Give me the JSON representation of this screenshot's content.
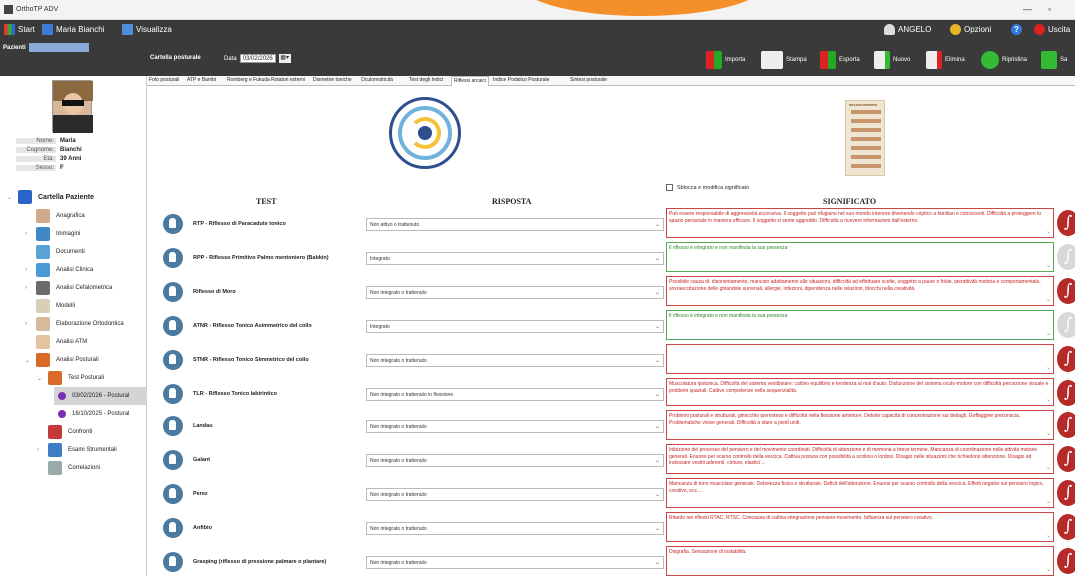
{
  "window": {
    "title": "OrthoTP ADV",
    "minimize": "—",
    "maximize": "▫"
  },
  "topbar": {
    "start": "Start",
    "user": "Maria Bianchi",
    "visualizza": "Visualizza",
    "account": "ANGELO",
    "options": "Opzioni",
    "help": "?",
    "exit": "Uscita"
  },
  "toolbar": {
    "pazienti": "Pazienti",
    "cartella": "Cartella posturale",
    "data_label": "Data",
    "data_value": "03/02/2026",
    "importa": "Importa",
    "stampa": "Stampa",
    "esporta": "Esporta",
    "nuovo": "Nuovo",
    "elimina": "Elimina",
    "ripristina": "Ripristina",
    "salva": "Sa"
  },
  "patient": {
    "nome_label": "Nome:",
    "nome": "Maria",
    "cognome_label": "Cognome:",
    "cognome": "Bianchi",
    "eta_label": "Età:",
    "eta": "39 Anni",
    "sesso_label": "Sesso:",
    "sesso": "F"
  },
  "tree": [
    {
      "label": "Cartella Paziente",
      "bold": true
    },
    {
      "label": "Anagrafica"
    },
    {
      "label": "Immagini"
    },
    {
      "label": "Documenti"
    },
    {
      "label": "Analisi Clinica"
    },
    {
      "label": "Analisi Cefalometrica"
    },
    {
      "label": "Modelli"
    },
    {
      "label": "Elaborazione Ortodontica"
    },
    {
      "label": "Analisi ATM"
    },
    {
      "label": "Analisi Posturali"
    },
    {
      "label": "Test Posturali"
    },
    {
      "label": "03/02/2026 - Postural"
    },
    {
      "label": "16/10/2025 - Postural"
    },
    {
      "label": "Confronti"
    },
    {
      "label": "Esami Strumentali"
    },
    {
      "label": "Correlazioni"
    }
  ],
  "tabs": [
    "Foto posturali",
    "ATP e Bambi",
    "Romberg e Fukuda",
    "Rotatori esterni",
    "Dismetrie toniche",
    "Oculomotricità",
    "Test degli Indici",
    "Riflessi arcaici",
    "Indice Podalico Posturale",
    "Sintesi posturale"
  ],
  "active_tab": 7,
  "content": {
    "test_header": "TEST",
    "risposta_header": "RISPOSTA",
    "significato_header": "SIGNIFICATO",
    "checkbox_label": "Sblocca e modifica significato",
    "poster_title": "RIFLESSI PRIMITIVI"
  },
  "rows": [
    {
      "label": "RTP - Riflesso di Paracadute tonico",
      "risposta": "Non attivo o trattenuto",
      "significato": "Può essere responsabile di aggressività eccessiva. Il soggetto può rifugiarsi nel suo mondo interiore divenendo criptico a familiari e conoscenti. Difficoltà a proteggere lo spazio personale in maniera efficace. Il soggetto si sente aggredito. Difficoltà a ricevere informazioni dall'esterno.",
      "ok": false
    },
    {
      "label": "RPP - Riflesso Primitivo Palmo mentoniero (Babkin)",
      "risposta": "Integrato",
      "significato": "Il riflesso è integrato e non manifesta la sua presenza",
      "ok": true
    },
    {
      "label": "Riflesso di Moro",
      "risposta": "Non integrato o trattenuto",
      "significato": "Possibile causa di: disorientamento, mancato adattamento alle situazioni, difficoltà ad effettuare scelte, soggetto a paure o fobie, iperattività motoria e comportamentale, sovraeccitazione delle ghiandole surrenali, allergie, infezioni, dipendenza nelle relazioni, blocchi nella creatività.",
      "ok": false
    },
    {
      "label": "ATNR - Riflesso Tonico Asimmetrico del collo",
      "risposta": "Integrato",
      "significato": "Il riflesso è integrato e non manifesta la sua presenza",
      "ok": true
    },
    {
      "label": "STNR - Riflesso Tonico Simmetrico del collo",
      "risposta": "Non integrato o trattenuto",
      "significato": "",
      "ok": false
    },
    {
      "label": "TLR - Riflesso Tonico labirintico",
      "risposta": "Non integrato o trattenuto in flessione",
      "significato": "Muscolatura ipotonica. Difficoltà del sistema vestibolare: cattivo equilibrio e tendenza al mal d'auto. Disfunzione del sistema oculo-motore con difficoltà percezione visuale e problemi spaziali. Cattive competenze nella sequenzialità.",
      "ok": false
    },
    {
      "label": "Landau",
      "risposta": "Non integrato o trattenuto",
      "significato": "Problemi posturali e strutturali, ginocchio iperesteso e difficoltà nella flessione anteriore. Debole capacità di concentrazione sui dettagli. Goffaggine preconscia. Problematiche visive generali. Difficoltà a stare a piedi uniti.",
      "ok": false
    },
    {
      "label": "Galant",
      "risposta": "Non integrato o trattenuto",
      "significato": "Inibizione del processo del pensiero e del movimento coordinati. Difficoltà di attenzione e di memoria a breve termine. Mancanza di coordinazione nelle attività motorie generali. Enuresi per scarso controllo della vescica. Cattiva postura con possibilità a scoliosi o lordosi. Disagio nelle situazioni che richiedono attenzione. Disagio ad indossare vestiti aderenti, cinture, elastici ...",
      "ok": false
    },
    {
      "label": "Perez",
      "risposta": "Non integrato o trattenuto",
      "significato": "Mancanza di tono muscolare generale. Debolezza fisica e strutturale. Deficit dell'attenzione. Enuresi per scarso controllo della vescica. Effetti negativi sul pensiero logico, creativo, ecc...",
      "ok": false
    },
    {
      "label": "Anfibio",
      "risposta": "Non integrato o trattenuto",
      "significato": "Ritardo nei riflessi RTAC, RTSC. Concausa di cattiva integrazione pensiero-movimento. Influenza sul pensiero creativo.",
      "ok": false
    },
    {
      "label": "Grasping (riflesso di pressione palmare o plantare)",
      "risposta": "Non integrato o trattenuto",
      "significato": "Disgrafia. Sensazione di instabilità.",
      "ok": false
    }
  ]
}
